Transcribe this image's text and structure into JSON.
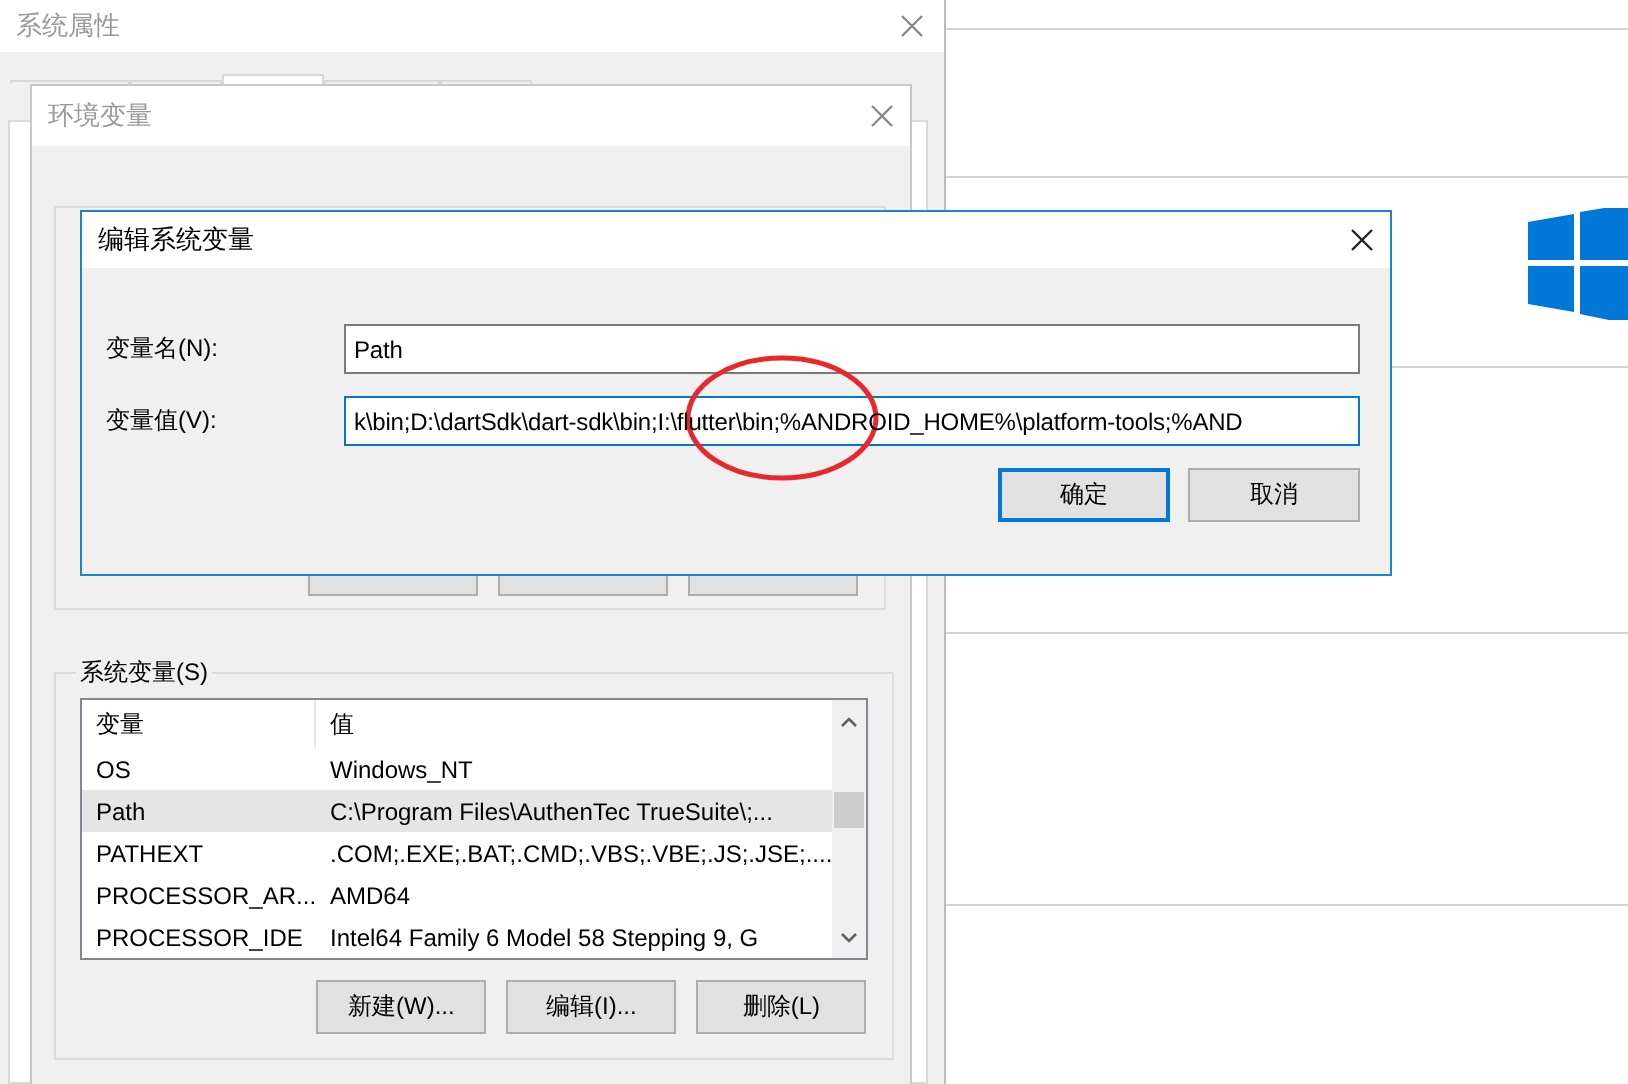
{
  "system_properties": {
    "title": "系统属性",
    "tabs": [
      {
        "selected": false
      },
      {
        "selected": false
      },
      {
        "selected": true
      },
      {
        "selected": false
      },
      {
        "selected": false
      }
    ]
  },
  "environment_variables": {
    "title": "环境变量",
    "system_variables": {
      "label": "系统变量(S)",
      "columns": [
        "变量",
        "值"
      ],
      "rows": [
        {
          "name": "OS",
          "value": "Windows_NT",
          "selected": false
        },
        {
          "name": "Path",
          "value": "C:\\Program Files\\AuthenTec TrueSuite\\;...",
          "selected": true
        },
        {
          "name": "PATHEXT",
          "value": ".COM;.EXE;.BAT;.CMD;.VBS;.VBE;.JS;.JSE;....",
          "selected": false
        },
        {
          "name": "PROCESSOR_AR...",
          "value": "AMD64",
          "selected": false
        },
        {
          "name": "PROCESSOR_IDE",
          "value": "Intel64 Family 6 Model 58 Stepping 9, G",
          "selected": false
        }
      ],
      "buttons": [
        "新建(W)...",
        "编辑(I)...",
        "删除(L)"
      ]
    }
  },
  "edit_dialog": {
    "title": "编辑系统变量",
    "fields": [
      {
        "label": "变量名(N):",
        "value": "Path",
        "focused": false
      },
      {
        "label": "变量值(V):",
        "value": "k\\bin;D:\\dartSdk\\dart-sdk\\bin;I:\\flutter\\bin;%ANDROID_HOME%\\platform-tools;%AND",
        "focused": true
      }
    ],
    "buttons": [
      {
        "label": "确定",
        "default": true
      },
      {
        "label": "取消",
        "default": false
      }
    ]
  }
}
